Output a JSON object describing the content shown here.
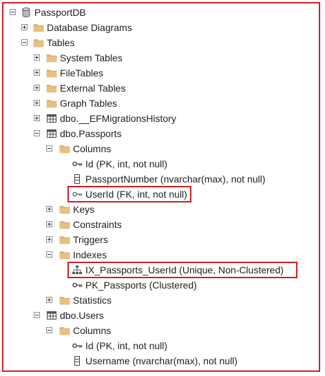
{
  "colors": {
    "highlight": "#d01c24",
    "folder": "#dcb67a"
  },
  "tree": [
    {
      "id": "db",
      "label": "PassportDB",
      "icon": "database-icon",
      "depth": 0,
      "toggle": "minus"
    },
    {
      "id": "diagrams",
      "label": "Database Diagrams",
      "icon": "folder-icon",
      "depth": 1,
      "toggle": "plus"
    },
    {
      "id": "tables",
      "label": "Tables",
      "icon": "folder-icon",
      "depth": 1,
      "toggle": "minus"
    },
    {
      "id": "systab",
      "label": "System Tables",
      "icon": "folder-icon",
      "depth": 2,
      "toggle": "plus"
    },
    {
      "id": "filetab",
      "label": "FileTables",
      "icon": "folder-icon",
      "depth": 2,
      "toggle": "plus"
    },
    {
      "id": "exttab",
      "label": "External Tables",
      "icon": "folder-icon",
      "depth": 2,
      "toggle": "plus"
    },
    {
      "id": "graphtab",
      "label": "Graph Tables",
      "icon": "folder-icon",
      "depth": 2,
      "toggle": "plus"
    },
    {
      "id": "efhist",
      "label": "dbo.__EFMigrationsHistory",
      "icon": "table-icon",
      "depth": 2,
      "toggle": "plus"
    },
    {
      "id": "passports",
      "label": "dbo.Passports",
      "icon": "table-icon",
      "depth": 2,
      "toggle": "minus"
    },
    {
      "id": "pcols",
      "label": "Columns",
      "icon": "folder-icon",
      "depth": 3,
      "toggle": "minus"
    },
    {
      "id": "pid",
      "label": "Id (PK, int, not null)",
      "icon": "key-icon",
      "depth": 4,
      "toggle": "none"
    },
    {
      "id": "pnum",
      "label": "PassportNumber (nvarchar(max), not null)",
      "icon": "column-icon",
      "depth": 4,
      "toggle": "none"
    },
    {
      "id": "puser",
      "label": "UserId (FK, int, not null)",
      "icon": "foreign-key-icon",
      "depth": 4,
      "toggle": "none",
      "highlight": true
    },
    {
      "id": "keys",
      "label": "Keys",
      "icon": "folder-icon",
      "depth": 3,
      "toggle": "plus"
    },
    {
      "id": "cons",
      "label": "Constraints",
      "icon": "folder-icon",
      "depth": 3,
      "toggle": "plus"
    },
    {
      "id": "trig",
      "label": "Triggers",
      "icon": "folder-icon",
      "depth": 3,
      "toggle": "plus"
    },
    {
      "id": "idx",
      "label": "Indexes",
      "icon": "folder-icon",
      "depth": 3,
      "toggle": "minus"
    },
    {
      "id": "ixuser",
      "label": "IX_Passports_UserId (Unique, Non-Clustered)",
      "icon": "index-icon",
      "depth": 4,
      "toggle": "none",
      "highlight": true
    },
    {
      "id": "pkpass",
      "label": "PK_Passports (Clustered)",
      "icon": "key-icon",
      "depth": 4,
      "toggle": "none"
    },
    {
      "id": "stats",
      "label": "Statistics",
      "icon": "folder-icon",
      "depth": 3,
      "toggle": "plus"
    },
    {
      "id": "users",
      "label": "dbo.Users",
      "icon": "table-icon",
      "depth": 2,
      "toggle": "minus"
    },
    {
      "id": "ucols",
      "label": "Columns",
      "icon": "folder-icon",
      "depth": 3,
      "toggle": "minus"
    },
    {
      "id": "uid",
      "label": "Id (PK, int, not null)",
      "icon": "key-icon",
      "depth": 4,
      "toggle": "none"
    },
    {
      "id": "uname",
      "label": "Username (nvarchar(max), not null)",
      "icon": "column-icon",
      "depth": 4,
      "toggle": "none"
    }
  ]
}
